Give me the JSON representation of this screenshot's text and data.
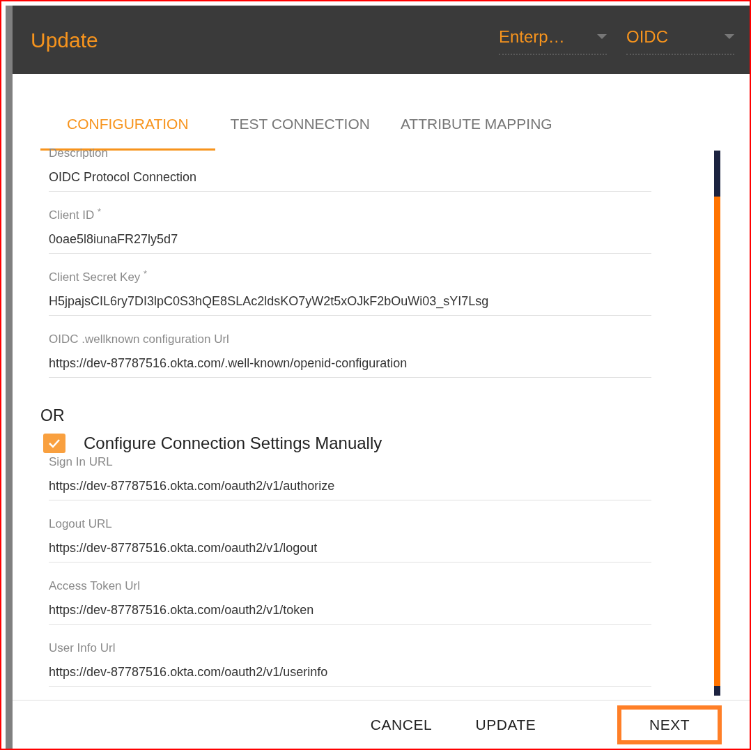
{
  "header": {
    "title": "Update",
    "dropdowns": [
      {
        "value": "Enterp…"
      },
      {
        "value": "OIDC"
      }
    ]
  },
  "tabs": [
    {
      "label": "CONFIGURATION",
      "selected": true
    },
    {
      "label": "TEST CONNECTION",
      "selected": false
    },
    {
      "label": "ATTRIBUTE MAPPING",
      "selected": false
    }
  ],
  "fields": [
    {
      "label": "Description",
      "value": "OIDC Protocol Connection"
    },
    {
      "label": "Client ID $^{*}$",
      "value": "0oae5l8iunaFR27ly5d7"
    },
    {
      "label": "Client Secret Key $^{*}$",
      "value": "H5jpajsCIL6ry7DI3lpC0S3hQE8SLAc2ldsKO7yW2t5xOJkF2bOuWi03_sYI7Lsg"
    },
    {
      "label": "OIDC .wellknown configuration Url",
      "value": "https://dev-87787516.okta.com/.well-known/openid-configuration"
    }
  ],
  "separator": "OR",
  "manual": {
    "label": "Configure Connection Settings Manually",
    "checked": true
  },
  "manual_fields": [
    {
      "label": "Sign In URL",
      "value": "https://dev-87787516.okta.com/oauth2/v1/authorize"
    },
    {
      "label": "Logout URL",
      "value": "https://dev-87787516.okta.com/oauth2/v1/logout"
    },
    {
      "label": "Access Token Url",
      "value": "https://dev-87787516.okta.com/oauth2/v1/token"
    },
    {
      "label": "User Info Url",
      "value": "https://dev-87787516.okta.com/oauth2/v1/userinfo"
    }
  ],
  "buttons": [
    {
      "label": "CANCEL",
      "highlighted": false
    },
    {
      "label": "UPDATE",
      "highlighted": false
    },
    {
      "label": "NEXT",
      "highlighted": true
    }
  ]
}
